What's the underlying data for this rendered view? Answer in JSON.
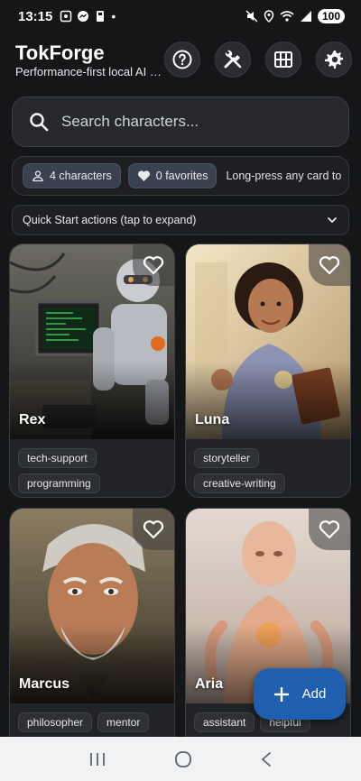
{
  "status": {
    "time": "13:15",
    "battery": "100"
  },
  "header": {
    "title": "TokForge",
    "subtitle": "Performance-first local AI c...",
    "buttons": [
      "help-icon",
      "tools-icon",
      "grid-icon",
      "gear-icon"
    ]
  },
  "search": {
    "placeholder": "Search characters..."
  },
  "filters": {
    "characters_chip": "4 characters",
    "favorites_chip": "0 favorites",
    "hint": "Long-press any card to"
  },
  "quickstart": {
    "label": "Quick Start actions (tap to expand)"
  },
  "cards": [
    {
      "name": "Rex",
      "tags": [
        "tech-support",
        "programming"
      ]
    },
    {
      "name": "Luna",
      "tags": [
        "storyteller",
        "creative-writing"
      ]
    },
    {
      "name": "Marcus",
      "tags": [
        "philosopher",
        "mentor"
      ]
    },
    {
      "name": "Aria",
      "tags": [
        "assistant",
        "helpful"
      ]
    }
  ],
  "fab": {
    "label": "Add"
  },
  "colors": {
    "background": "#151618",
    "accent": "#1f5fae",
    "chip": "#3a4250"
  }
}
